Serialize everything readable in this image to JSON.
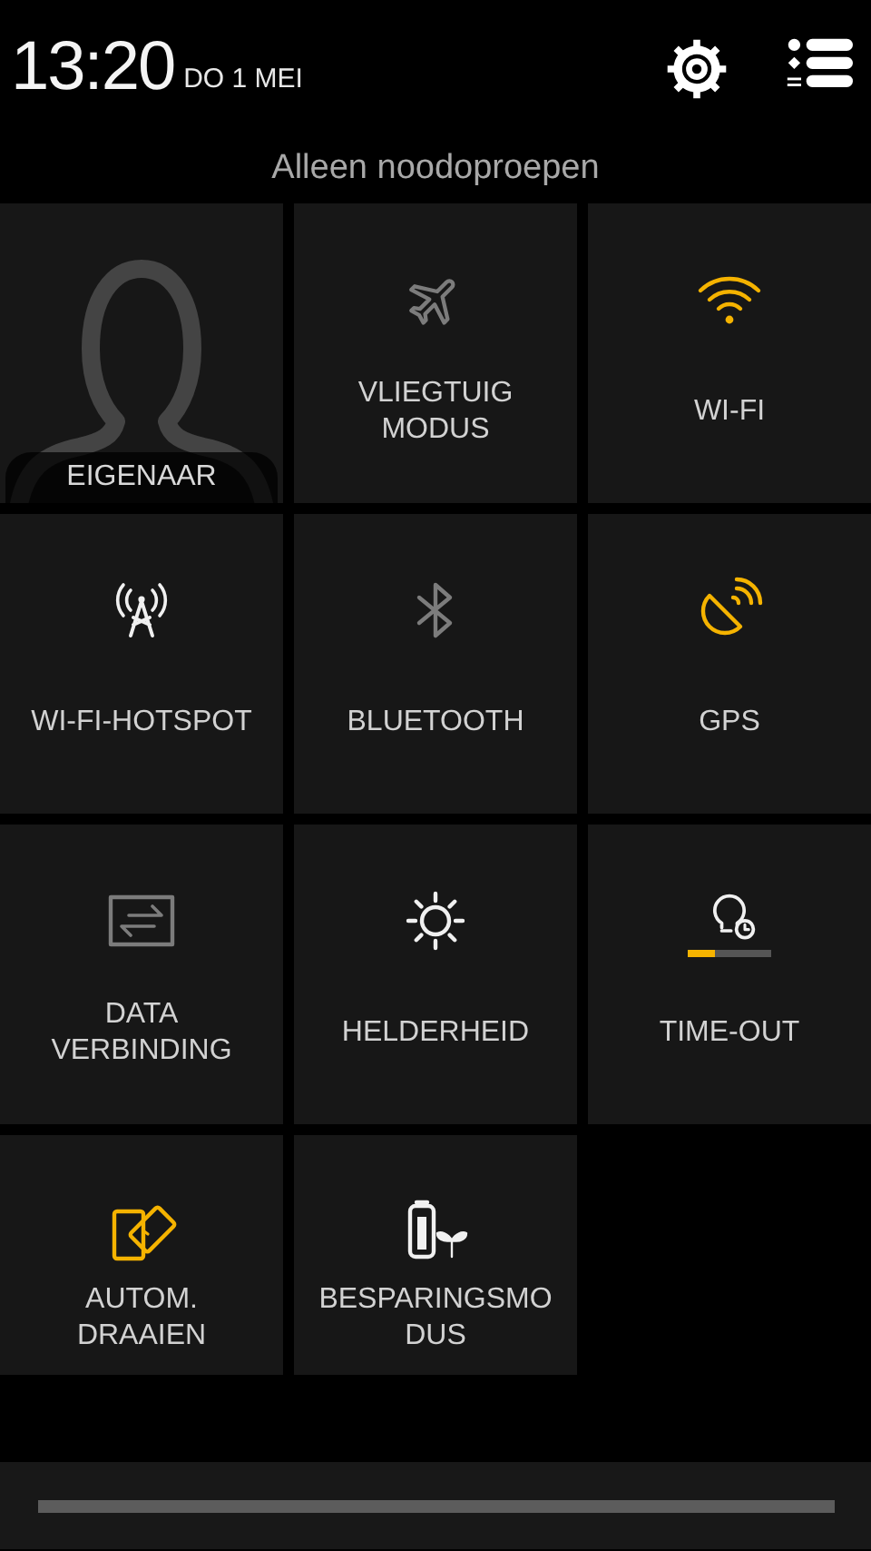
{
  "header": {
    "time": "13:20",
    "date": "DO 1 MEI"
  },
  "status_text": "Alleen noodoproepen",
  "tiles": [
    {
      "kind": "owner",
      "label_lines": [
        "EIGENAAR"
      ]
    },
    {
      "kind": "airplane",
      "on": false,
      "dimmed": true,
      "label_lines": [
        "VLIEGTUIG",
        "MODUS"
      ]
    },
    {
      "kind": "wifi",
      "on": true,
      "label_lines": [
        "WI-FI"
      ]
    },
    {
      "kind": "hotspot",
      "on": false,
      "dimmed": false,
      "label_lines": [
        "WI-FI-HOTSPOT"
      ]
    },
    {
      "kind": "bluetooth",
      "on": false,
      "dimmed": true,
      "label_lines": [
        "BLUETOOTH"
      ]
    },
    {
      "kind": "gps",
      "on": true,
      "label_lines": [
        "GPS"
      ]
    },
    {
      "kind": "data",
      "on": false,
      "dimmed": true,
      "label_lines": [
        "DATA",
        "VERBINDING"
      ]
    },
    {
      "kind": "brightness",
      "on": false,
      "dimmed": false,
      "label_lines": [
        "HELDERHEID"
      ]
    },
    {
      "kind": "timeout",
      "on": false,
      "dimmed": false,
      "level": 0.33,
      "label_lines": [
        "TIME-OUT"
      ]
    },
    {
      "kind": "rotate",
      "on": true,
      "label_lines": [
        "AUTOM.",
        "DRAAIEN"
      ]
    },
    {
      "kind": "powersave",
      "on": false,
      "dimmed": false,
      "label_lines": [
        "BESPARINGSMO",
        "DUS"
      ]
    }
  ]
}
